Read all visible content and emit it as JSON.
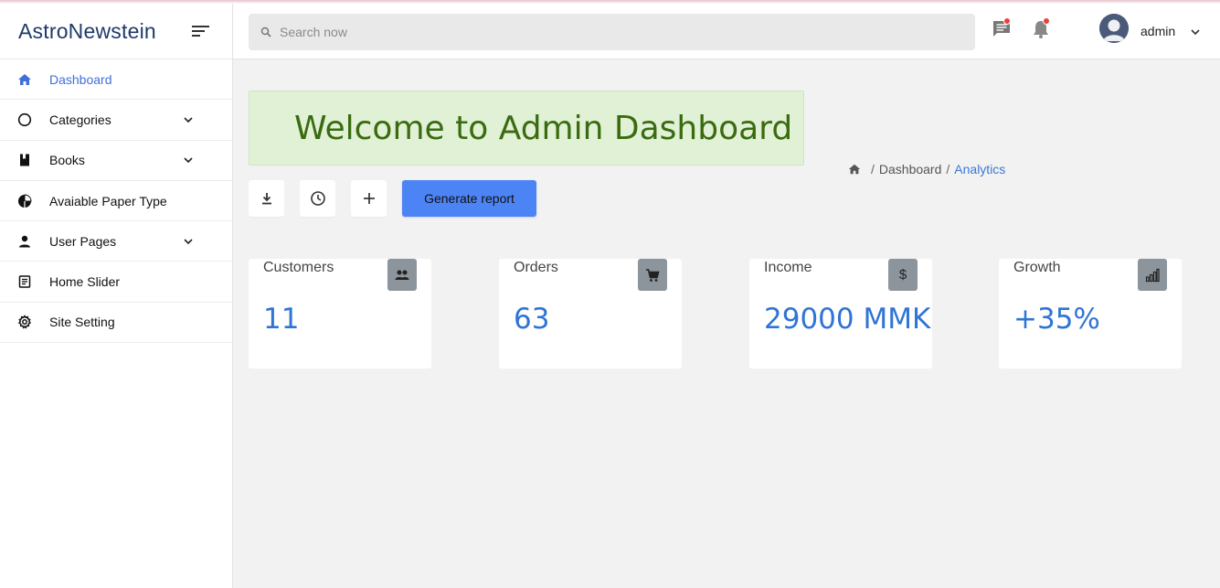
{
  "sidebar": {
    "brand": "AstroNewstein",
    "items": [
      {
        "label": "Dashboard",
        "icon": "home-icon",
        "active": true,
        "has_children": false
      },
      {
        "label": "Categories",
        "icon": "circle-icon",
        "active": false,
        "has_children": true
      },
      {
        "label": "Books",
        "icon": "book-icon",
        "active": false,
        "has_children": true
      },
      {
        "label": "Avaiable Paper Type",
        "icon": "pie-chart-icon",
        "active": false,
        "has_children": false
      },
      {
        "label": "User Pages",
        "icon": "person-icon",
        "active": false,
        "has_children": true
      },
      {
        "label": "Home Slider",
        "icon": "document-icon",
        "active": false,
        "has_children": false
      },
      {
        "label": "Site Setting",
        "icon": "gear-icon",
        "active": false,
        "has_children": false
      }
    ]
  },
  "header": {
    "search_placeholder": "Search now",
    "search_value": "",
    "username": "admin"
  },
  "main": {
    "welcome": "Welcome to Admin Dashboard",
    "breadcrumb": [
      "Dashboard",
      "Analytics"
    ],
    "generate_label": "Generate report",
    "cards": [
      {
        "title": "Customers",
        "value": "11",
        "icon": "people-icon"
      },
      {
        "title": "Orders",
        "value": "63",
        "icon": "cart-icon"
      },
      {
        "title": "Income",
        "value": "29000 MMK",
        "icon": "dollar-icon"
      },
      {
        "title": "Growth",
        "value": "+35%",
        "icon": "bar-chart-icon"
      }
    ]
  },
  "colors": {
    "accent": "#4d84f5",
    "brand": "#1f3a6b",
    "welcome_bg": "#e1f1d6",
    "welcome_text": "#3a6b10",
    "stat_value": "#2f74d6",
    "notification_dot": "#f03e3e"
  }
}
